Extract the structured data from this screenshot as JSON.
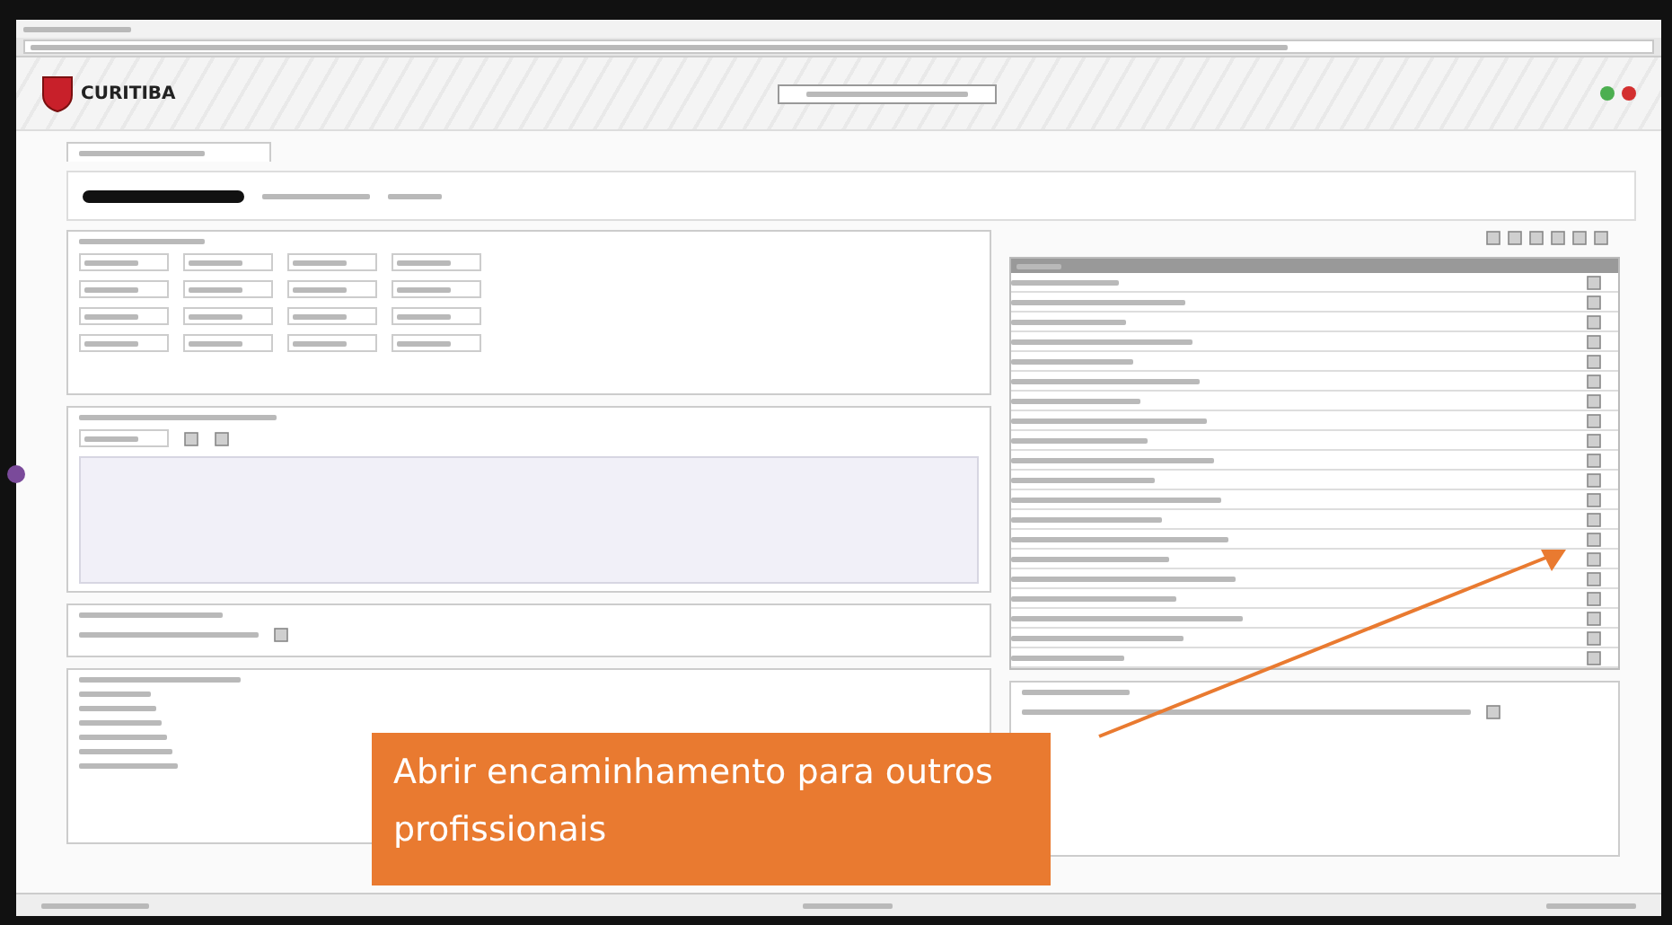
{
  "header": {
    "title": "CURITIBA"
  },
  "callout": {
    "text": "Abrir encaminhamento para outros profissionais"
  }
}
